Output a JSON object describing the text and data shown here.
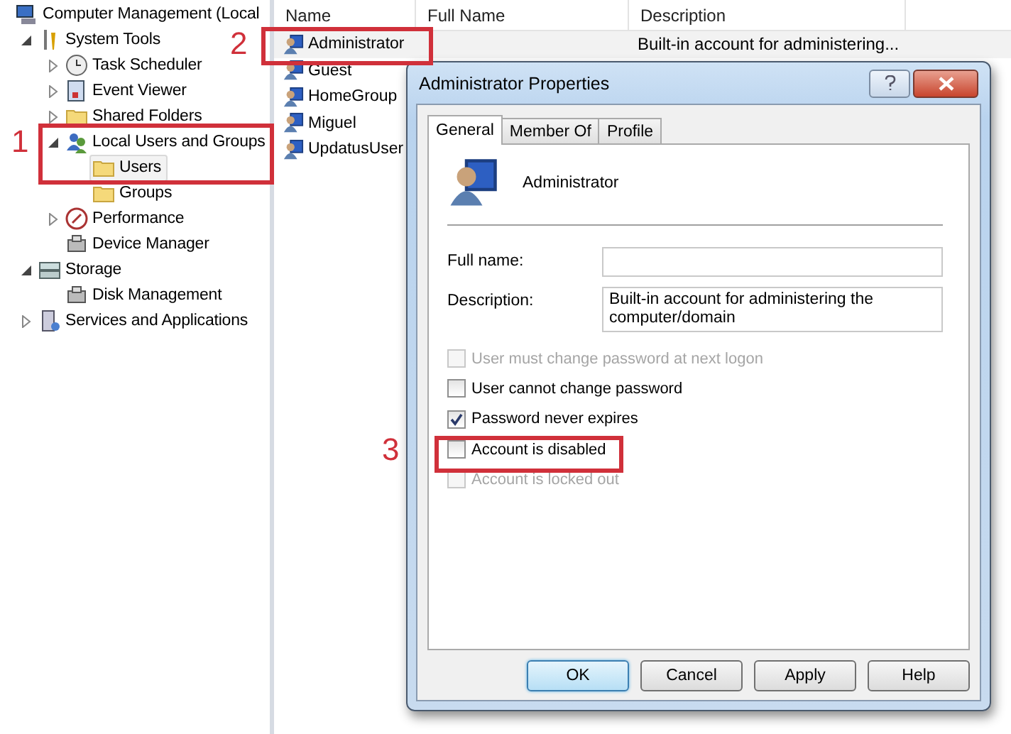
{
  "tree": [
    {
      "label": "Computer Management (Local",
      "selected": false,
      "children": [
        {
          "label": "System Tools",
          "selected": false,
          "expanded": true,
          "children": [
            {
              "label": "Task Scheduler",
              "selected": false,
              "expanded": false
            },
            {
              "label": "Event Viewer",
              "selected": false,
              "expanded": false
            },
            {
              "label": "Shared Folders",
              "selected": false,
              "expanded": false
            },
            {
              "label": "Local Users and Groups",
              "selected": false,
              "expanded": true,
              "children": [
                {
                  "label": "Users",
                  "selected": true
                },
                {
                  "label": "Groups",
                  "selected": false
                }
              ]
            },
            {
              "label": "Performance",
              "selected": false,
              "expanded": false
            },
            {
              "label": "Device Manager",
              "selected": false
            }
          ]
        },
        {
          "label": "Storage",
          "selected": false,
          "expanded": true,
          "children": [
            {
              "label": "Disk Management",
              "selected": false
            }
          ]
        },
        {
          "label": "Services and Applications",
          "selected": false,
          "expanded": false
        }
      ]
    }
  ],
  "list": {
    "columns": [
      "Name",
      "Full Name",
      "Description"
    ],
    "rows": [
      {
        "name": "Administrator",
        "description": "Built-in account for administering...",
        "selected": true
      },
      {
        "name": "Guest",
        "selected": false
      },
      {
        "name": "HomeGroup",
        "selected": false
      },
      {
        "name": "Miguel",
        "selected": false
      },
      {
        "name": "UpdatusUser",
        "selected": false
      }
    ]
  },
  "dialog": {
    "title": "Administrator Properties",
    "tabs": [
      {
        "label": "General",
        "selected": true
      },
      {
        "label": "Member Of",
        "selected": false
      },
      {
        "label": "Profile",
        "selected": false
      }
    ],
    "user_name": "Administrator",
    "fields": [
      {
        "label": "Full name:"
      },
      {
        "label": "Description:",
        "value": "Built-in account for administering the computer/domain"
      }
    ],
    "options": [
      {
        "label": "User must change password at next logon",
        "checked": false,
        "disabled": true
      },
      {
        "label": "User cannot change password",
        "checked": false,
        "disabled": false
      },
      {
        "label": "Password never expires",
        "checked": true,
        "disabled": false
      },
      {
        "label": "Account is disabled",
        "checked": false,
        "disabled": false
      },
      {
        "label": "Account is locked out",
        "checked": false,
        "disabled": true
      }
    ],
    "buttons": [
      {
        "label": "OK",
        "default": true
      },
      {
        "label": "Cancel",
        "default": false
      },
      {
        "label": "Apply",
        "default": false
      },
      {
        "label": "Help",
        "default": false
      }
    ]
  },
  "annotations": [
    {
      "label": "1"
    },
    {
      "label": "2"
    },
    {
      "label": "3"
    }
  ]
}
